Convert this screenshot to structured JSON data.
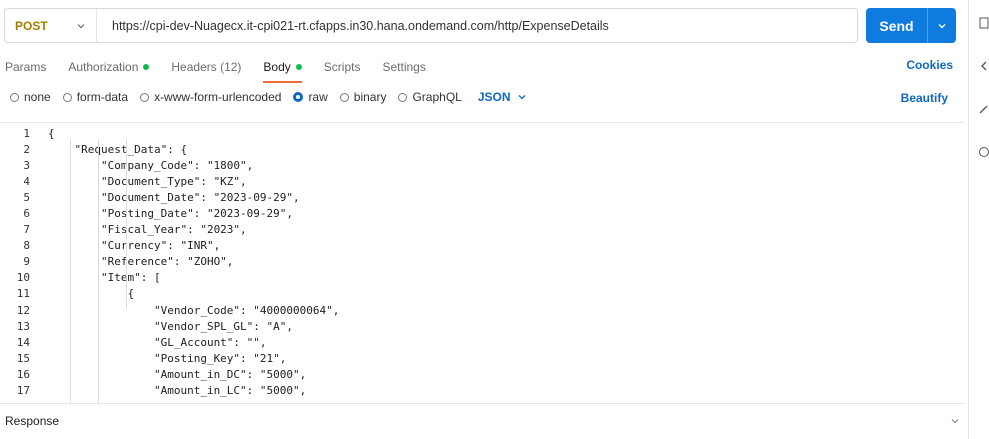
{
  "request": {
    "method": "POST",
    "url": "https://cpi-dev-Nuagecx.it-cpi021-rt.cfapps.in30.hana.ondemand.com/http/ExpenseDetails",
    "send_label": "Send"
  },
  "tabs": [
    {
      "label": "Params"
    },
    {
      "label": "Authorization"
    },
    {
      "label": "Headers (12)"
    },
    {
      "label": "Body"
    },
    {
      "label": "Scripts"
    },
    {
      "label": "Settings"
    }
  ],
  "cookies_label": "Cookies",
  "body_options": [
    "none",
    "form-data",
    "x-www-form-urlencoded",
    "raw",
    "binary",
    "GraphQL"
  ],
  "format_label": "JSON",
  "beautify_label": "Beautify",
  "code_lines": [
    "{",
    "    \"Request_Data\": {",
    "        \"Company_Code\": \"1800\",",
    "        \"Document_Type\": \"KZ\",",
    "        \"Document_Date\": \"2023-09-29\",",
    "        \"Posting_Date\": \"2023-09-29\",",
    "        \"Fiscal_Year\": \"2023\",",
    "        \"Currency\": \"INR\",",
    "        \"Reference\": \"ZOHO\",",
    "        \"Item\": [",
    "            {",
    "                \"Vendor_Code\": \"4000000064\",",
    "                \"Vendor_SPL_GL\": \"A\",",
    "                \"GL_Account\": \"\",",
    "                \"Posting_Key\": \"21\",",
    "                \"Amount_in_DC\": \"5000\",",
    "                \"Amount_in_LC\": \"5000\","
  ],
  "response_label": "Response",
  "colors": {
    "accent": "#0f7bde",
    "method": "#a67c00",
    "active_tab": "#f26b3a",
    "dot": "#0cbb52"
  }
}
